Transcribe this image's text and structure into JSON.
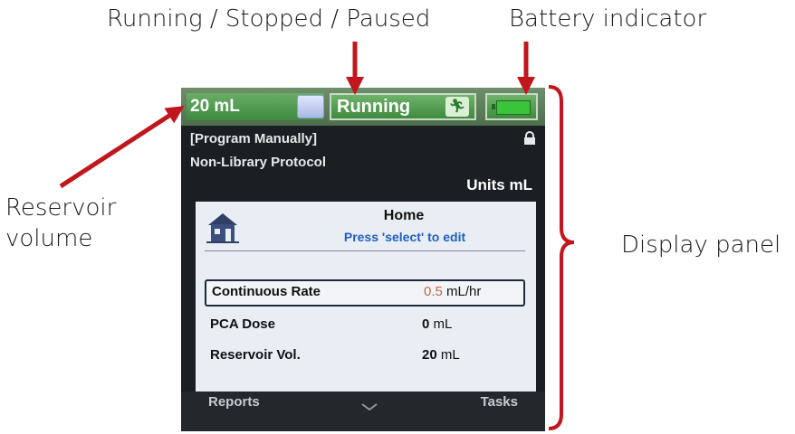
{
  "callouts": {
    "running_state": "Running / Stopped / Paused",
    "battery": "Battery indicator",
    "reservoir_line1": "Reservoir",
    "reservoir_line2": "volume",
    "display": "Display panel"
  },
  "colors": {
    "arrow": "#c0161c",
    "status_green": "#4f8f4a",
    "panel_bg": "#e9eef5",
    "hint_blue": "#1f5fbf"
  },
  "status_bar": {
    "reservoir_volume": "20 mL",
    "state": "Running",
    "run_icon": "running-person-icon",
    "battery_icon": "battery-full-icon",
    "battery_level": 1.0
  },
  "program": {
    "mode": "[Program Manually]",
    "protocol": "Non-Library Protocol",
    "units": "Units mL",
    "lock_icon": "lock-icon"
  },
  "home": {
    "icon": "home-icon",
    "title": "Home",
    "hint": "Press 'select' to edit",
    "rows": [
      {
        "label": "Continuous Rate",
        "value": "0.5",
        "unit": "mL/hr",
        "selected": true
      },
      {
        "label": "PCA Dose",
        "value": "0",
        "unit": "mL",
        "selected": false
      },
      {
        "label": "Reservoir Vol.",
        "value": "20",
        "unit": "mL",
        "selected": false
      }
    ]
  },
  "softkeys": {
    "left": "Reports",
    "right": "Tasks",
    "scroll_icon": "chevron-down-icon"
  }
}
